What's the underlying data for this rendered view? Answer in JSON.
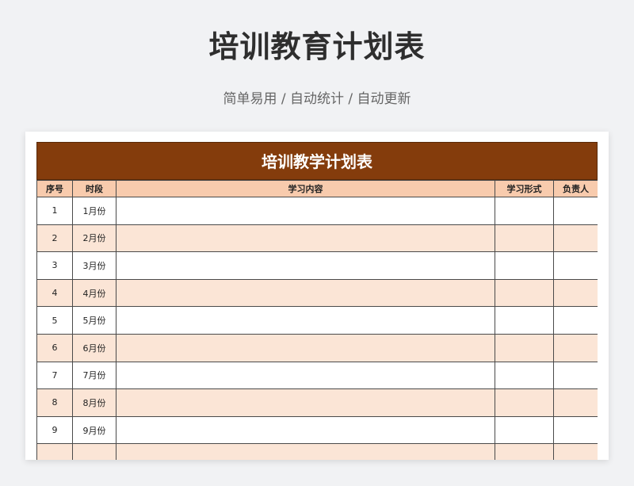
{
  "page": {
    "title": "培训教育计划表",
    "subtitle": "简单易用 / 自动统计 / 自动更新"
  },
  "sheet": {
    "title": "培训教学计划表",
    "columns": [
      "序号",
      "时段",
      "学习内容",
      "学习形式",
      "负责人"
    ],
    "rows": [
      {
        "no": "1",
        "period": "1月份",
        "content": "",
        "format": "",
        "owner": ""
      },
      {
        "no": "2",
        "period": "2月份",
        "content": "",
        "format": "",
        "owner": ""
      },
      {
        "no": "3",
        "period": "3月份",
        "content": "",
        "format": "",
        "owner": ""
      },
      {
        "no": "4",
        "period": "4月份",
        "content": "",
        "format": "",
        "owner": ""
      },
      {
        "no": "5",
        "period": "5月份",
        "content": "",
        "format": "",
        "owner": ""
      },
      {
        "no": "6",
        "period": "6月份",
        "content": "",
        "format": "",
        "owner": ""
      },
      {
        "no": "7",
        "period": "7月份",
        "content": "",
        "format": "",
        "owner": ""
      },
      {
        "no": "8",
        "period": "8月份",
        "content": "",
        "format": "",
        "owner": ""
      },
      {
        "no": "9",
        "period": "9月份",
        "content": "",
        "format": "",
        "owner": ""
      },
      {
        "no": "",
        "period": "",
        "content": "",
        "format": "",
        "owner": ""
      }
    ]
  },
  "colors": {
    "title_bar": "#843c0c",
    "header_bg": "#f8cbad",
    "stripe_bg": "#fbe5d6"
  }
}
